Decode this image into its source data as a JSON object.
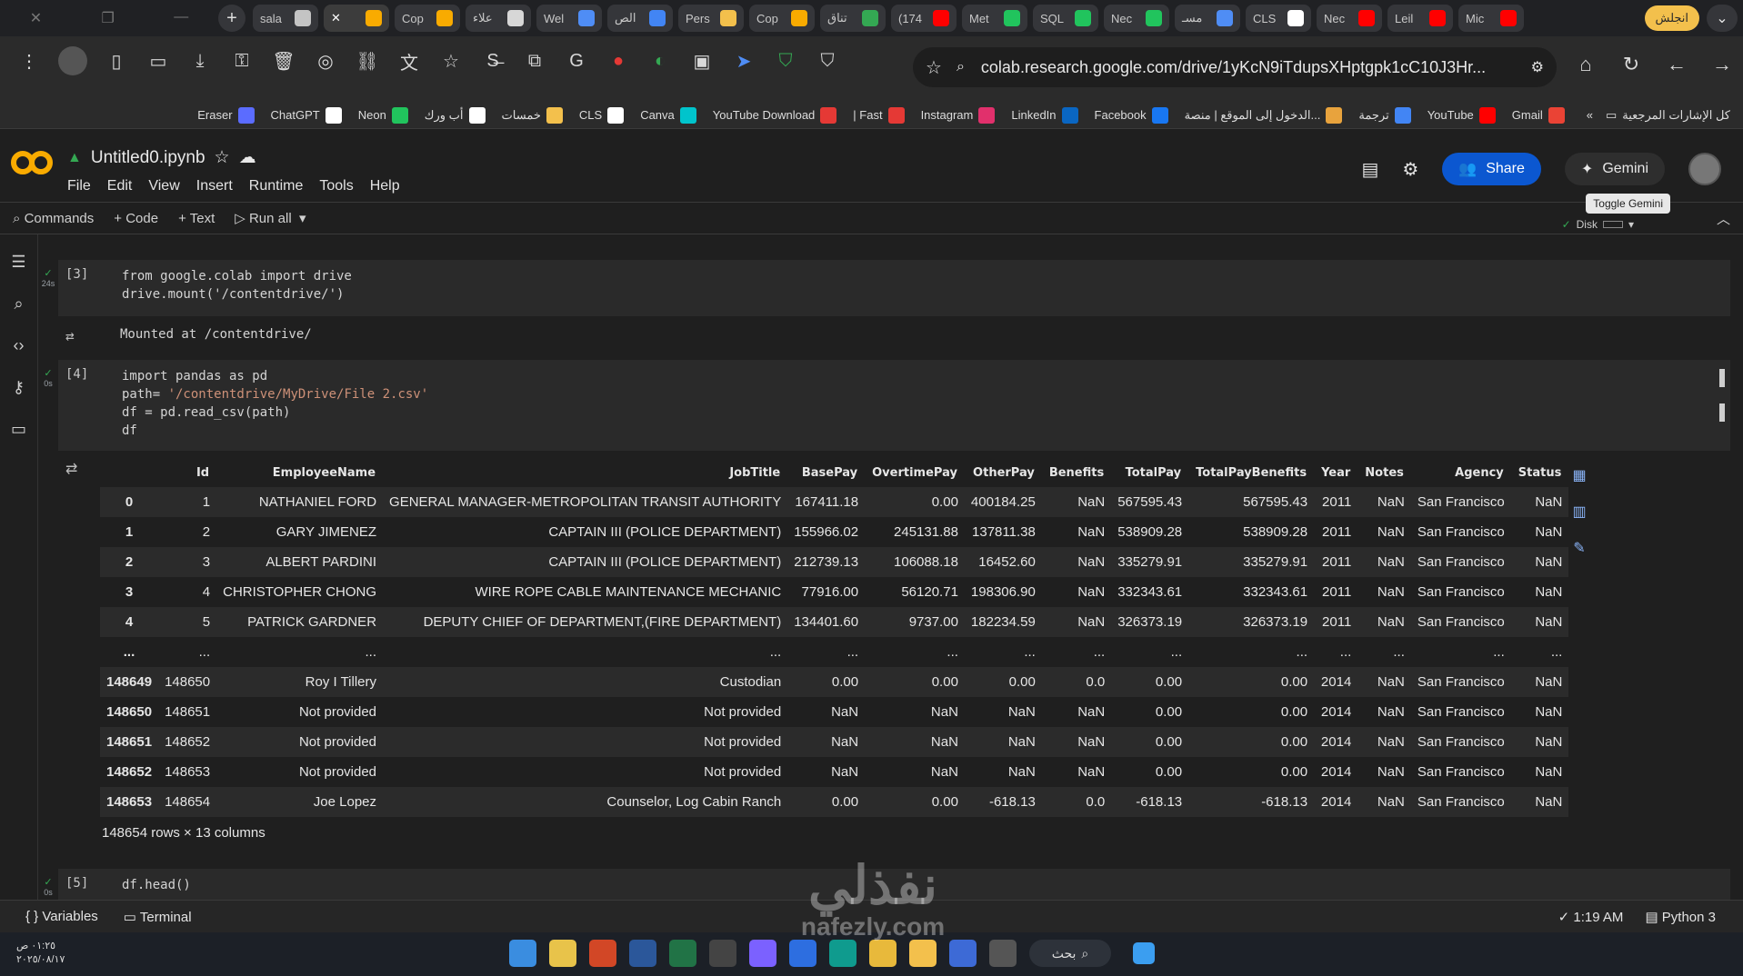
{
  "browser": {
    "tabs": [
      {
        "label": "sala",
        "color": "#c4c4c4"
      },
      {
        "label": "",
        "color": "#f9ab00",
        "active": true
      },
      {
        "label": "Cop",
        "color": "#f9ab00"
      },
      {
        "label": "علاء",
        "color": "#d7d7d7"
      },
      {
        "label": "Wel",
        "color": "#4f8df5"
      },
      {
        "label": "الص",
        "color": "#4285f4"
      },
      {
        "label": "Pers",
        "color": "#f3c04c"
      },
      {
        "label": "Cop",
        "color": "#f9ab00"
      },
      {
        "label": "تناق",
        "color": "#34a853"
      },
      {
        "label": "(174",
        "color": "#ff0000"
      },
      {
        "label": "Met",
        "color": "#21c45d"
      },
      {
        "label": "SQL",
        "color": "#21c45d"
      },
      {
        "label": "Nec",
        "color": "#21c45d"
      },
      {
        "label": "مسـ",
        "color": "#4f8df5"
      },
      {
        "label": "CLS",
        "color": "#ffffff"
      },
      {
        "label": "Nec",
        "color": "#ff0000"
      },
      {
        "label": "Leil",
        "color": "#ff0000"
      },
      {
        "label": "Mic",
        "color": "#ff0000"
      }
    ],
    "profile_label": "انجلش",
    "url": "colab.research.google.com/drive/1yKcN9iTdupsXHptgpk1cC10J3Hr..."
  },
  "bookmarks": [
    {
      "label": "Gmail",
      "color": "#ea4335"
    },
    {
      "label": "YouTube",
      "color": "#ff0000"
    },
    {
      "label": "ترجمة",
      "color": "#4285f4"
    },
    {
      "label": "الدخول إلى الموقع | منصة...",
      "color": "#e8a33d"
    },
    {
      "label": "Facebook",
      "color": "#1877f2"
    },
    {
      "label": "LinkedIn",
      "color": "#0a66c2"
    },
    {
      "label": "Instagram",
      "color": "#e1306c"
    },
    {
      "label": "| Fast",
      "color": "#e53935"
    },
    {
      "label": "YouTube Download",
      "color": "#e53935"
    },
    {
      "label": "Canva",
      "color": "#00c4cc"
    },
    {
      "label": "CLS",
      "color": "#ffffff"
    },
    {
      "label": "خمسات",
      "color": "#f3c04c"
    },
    {
      "label": "أب ورك",
      "color": "#ffffff"
    },
    {
      "label": "Neon",
      "color": "#21c45d"
    },
    {
      "label": "ChatGPT",
      "color": "#ffffff"
    },
    {
      "label": "Eraser",
      "color": "#5b6cff"
    }
  ],
  "bookmarks_all_label": "كل الإشارات المرجعية",
  "colab": {
    "notebook_title": "Untitled0.ipynb",
    "menu": [
      "File",
      "Edit",
      "View",
      "Insert",
      "Runtime",
      "Tools",
      "Help"
    ],
    "share_label": "Share",
    "gemini_label": "Gemini",
    "tooltip": "Toggle Gemini",
    "disk_label": "Disk",
    "commands_label": "Commands",
    "code_label": "+ Code",
    "text_label": "+ Text",
    "run_all_label": "Run all"
  },
  "cells": [
    {
      "count": "[3]",
      "time": "24s",
      "code": [
        "from google.colab import drive",
        "drive.mount('/contentdrive/')"
      ],
      "output": "Mounted at /contentdrive/"
    },
    {
      "count": "[4]",
      "time": "0s",
      "code_line1": "import pandas as pd",
      "code_line2_a": "path= ",
      "code_line2_str": "'/contentdrive/MyDrive/File 2.csv'",
      "code_line3_a": "df = pd.read_csv(path)",
      "code_line4": "df"
    },
    {
      "count": "[5]",
      "time": "0s",
      "code": "df.head()"
    }
  ],
  "dataframe": {
    "columns": [
      "",
      "Id",
      "EmployeeName",
      "JobTitle",
      "BasePay",
      "OvertimePay",
      "OtherPay",
      "Benefits",
      "TotalPay",
      "TotalPayBenefits",
      "Year",
      "Notes",
      "Agency",
      "Status"
    ],
    "rows": [
      [
        "0",
        "1",
        "NATHANIEL FORD",
        "GENERAL MANAGER-METROPOLITAN TRANSIT AUTHORITY",
        "167411.18",
        "0.00",
        "400184.25",
        "NaN",
        "567595.43",
        "567595.43",
        "2011",
        "NaN",
        "San Francisco",
        "NaN"
      ],
      [
        "1",
        "2",
        "GARY JIMENEZ",
        "CAPTAIN III (POLICE DEPARTMENT)",
        "155966.02",
        "245131.88",
        "137811.38",
        "NaN",
        "538909.28",
        "538909.28",
        "2011",
        "NaN",
        "San Francisco",
        "NaN"
      ],
      [
        "2",
        "3",
        "ALBERT PARDINI",
        "CAPTAIN III (POLICE DEPARTMENT)",
        "212739.13",
        "106088.18",
        "16452.60",
        "NaN",
        "335279.91",
        "335279.91",
        "2011",
        "NaN",
        "San Francisco",
        "NaN"
      ],
      [
        "3",
        "4",
        "CHRISTOPHER CHONG",
        "WIRE ROPE CABLE MAINTENANCE MECHANIC",
        "77916.00",
        "56120.71",
        "198306.90",
        "NaN",
        "332343.61",
        "332343.61",
        "2011",
        "NaN",
        "San Francisco",
        "NaN"
      ],
      [
        "4",
        "5",
        "PATRICK GARDNER",
        "DEPUTY CHIEF OF DEPARTMENT,(FIRE DEPARTMENT)",
        "134401.60",
        "9737.00",
        "182234.59",
        "NaN",
        "326373.19",
        "326373.19",
        "2011",
        "NaN",
        "San Francisco",
        "NaN"
      ],
      [
        "...",
        "...",
        "...",
        "...",
        "...",
        "...",
        "...",
        "...",
        "...",
        "...",
        "...",
        "...",
        "...",
        "..."
      ],
      [
        "148649",
        "148650",
        "Roy I Tillery",
        "Custodian",
        "0.00",
        "0.00",
        "0.00",
        "0.0",
        "0.00",
        "0.00",
        "2014",
        "NaN",
        "San Francisco",
        "NaN"
      ],
      [
        "148650",
        "148651",
        "Not provided",
        "Not provided",
        "NaN",
        "NaN",
        "NaN",
        "NaN",
        "0.00",
        "0.00",
        "2014",
        "NaN",
        "San Francisco",
        "NaN"
      ],
      [
        "148651",
        "148652",
        "Not provided",
        "Not provided",
        "NaN",
        "NaN",
        "NaN",
        "NaN",
        "0.00",
        "0.00",
        "2014",
        "NaN",
        "San Francisco",
        "NaN"
      ],
      [
        "148652",
        "148653",
        "Not provided",
        "Not provided",
        "NaN",
        "NaN",
        "NaN",
        "NaN",
        "0.00",
        "0.00",
        "2014",
        "NaN",
        "San Francisco",
        "NaN"
      ],
      [
        "148653",
        "148654",
        "Joe Lopez",
        "Counselor, Log Cabin Ranch",
        "0.00",
        "0.00",
        "-618.13",
        "0.0",
        "-618.13",
        "-618.13",
        "2014",
        "NaN",
        "San Francisco",
        "NaN"
      ]
    ],
    "footer": "148654 rows × 13 columns"
  },
  "statusbar": {
    "variables_label": "Variables",
    "terminal_label": "Terminal",
    "time": "1:19 AM",
    "runtime": "Python 3"
  },
  "taskbar": {
    "date_line1": "٠١:٢٥ ص",
    "date_line2": "٢٠٢٥/٠٨/١٧",
    "search_label": "بحث"
  },
  "watermark": {
    "title": "نفذلي",
    "subtitle": "nafezly.com"
  }
}
